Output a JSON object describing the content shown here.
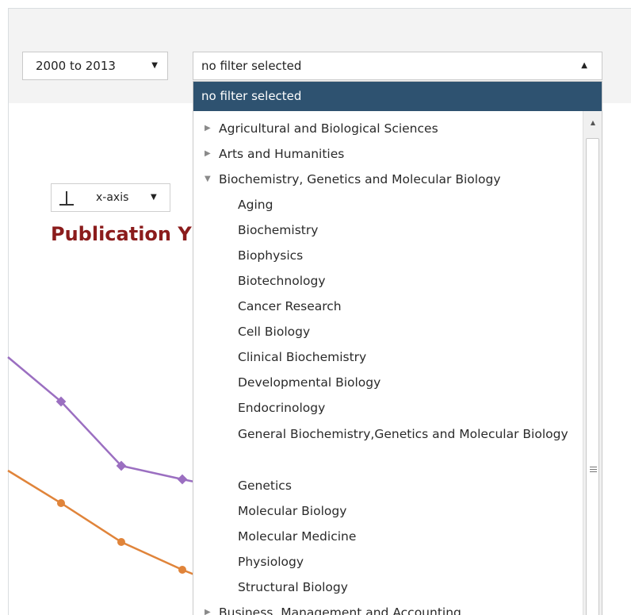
{
  "toolbar": {
    "year_range": "2000 to 2013",
    "filter_value": "no filter selected"
  },
  "axis_button": {
    "label": "x-axis"
  },
  "chart": {
    "title_visible": "Publication Y",
    "series_colors": [
      "#9b6fc1",
      "#e0843a"
    ]
  },
  "dropdown": {
    "selected": "no filter selected",
    "items": [
      {
        "type": "cat",
        "state": "collapsed",
        "label": "Agricultural and Biological Sciences"
      },
      {
        "type": "cat",
        "state": "collapsed",
        "label": "Arts and Humanities"
      },
      {
        "type": "cat",
        "state": "expanded",
        "label": "Biochemistry, Genetics and Molecular Biology"
      },
      {
        "type": "sub",
        "label": "Aging"
      },
      {
        "type": "sub",
        "label": "Biochemistry"
      },
      {
        "type": "sub",
        "label": "Biophysics"
      },
      {
        "type": "sub",
        "label": "Biotechnology"
      },
      {
        "type": "sub",
        "label": "Cancer Research"
      },
      {
        "type": "sub",
        "label": "Cell Biology"
      },
      {
        "type": "sub",
        "label": "Clinical Biochemistry"
      },
      {
        "type": "sub",
        "label": "Developmental Biology"
      },
      {
        "type": "sub",
        "label": "Endocrinology"
      },
      {
        "type": "sub",
        "label": "General Biochemistry,Genetics and Molecular Biology"
      },
      {
        "type": "sub",
        "label": "Genetics"
      },
      {
        "type": "sub",
        "label": "Molecular Biology"
      },
      {
        "type": "sub",
        "label": "Molecular Medicine"
      },
      {
        "type": "sub",
        "label": "Physiology"
      },
      {
        "type": "sub",
        "label": "Structural Biology"
      },
      {
        "type": "cat",
        "state": "collapsed",
        "label": "Business, Management and Accounting"
      }
    ]
  },
  "icons": {
    "collapsed": "▶",
    "expanded": "▼",
    "caret_down": "▼",
    "caret_up": "▲"
  }
}
